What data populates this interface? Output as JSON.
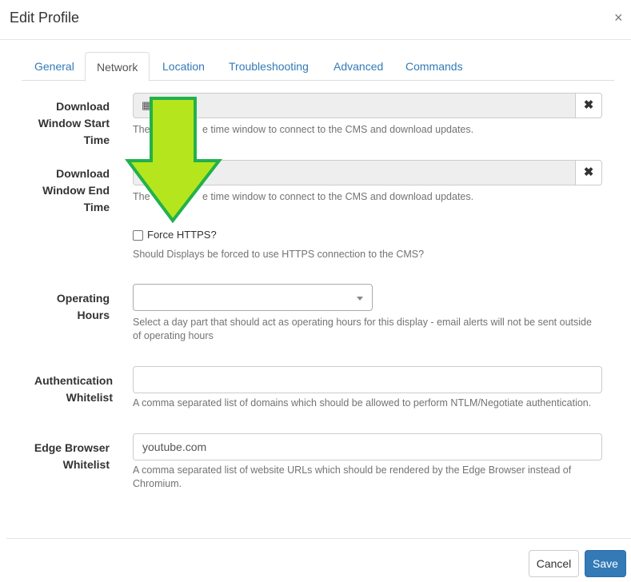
{
  "dialog": {
    "title": "Edit Profile",
    "close_label": "×"
  },
  "tabs": [
    {
      "label": "General"
    },
    {
      "label": "Network"
    },
    {
      "label": "Location"
    },
    {
      "label": "Troubleshooting"
    },
    {
      "label": "Advanced"
    },
    {
      "label": "Commands"
    }
  ],
  "active_tab": "Network",
  "form": {
    "download_start": {
      "label_lines": [
        "Download",
        "Window Start",
        "Time"
      ],
      "value": "",
      "help_left": "The",
      "help_right": "e time window to connect to the CMS and download updates.",
      "clear_label": "✖"
    },
    "download_end": {
      "label_lines": [
        "Download",
        "Window End",
        "Time"
      ],
      "value": "",
      "help_left": "The",
      "help_right": "e time window to connect to the CMS and download updates.",
      "clear_label": "✖"
    },
    "force_https": {
      "label": "Force HTTPS?",
      "checked": false,
      "help": "Should Displays be forced to use HTTPS connection to the CMS?"
    },
    "operating_hours": {
      "label_lines": [
        "Operating",
        "Hours"
      ],
      "selected_value": "",
      "help_lines": [
        "Select a day part that should act as operating hours for this display - email alerts will not be sent outside",
        "of operating hours"
      ]
    },
    "auth_whitelist": {
      "label_lines": [
        "Authentication",
        "Whitelist"
      ],
      "value": "",
      "help": "A comma separated list of domains which should be allowed to perform NTLM/Negotiate authentication."
    },
    "edge_whitelist": {
      "label_lines": [
        "Edge Browser",
        "Whitelist"
      ],
      "value": "youtube.com",
      "help_lines": [
        "A comma separated list of website URLs which should be rendered by the Edge Browser instead of",
        "Chromium."
      ]
    }
  },
  "footer": {
    "cancel_label": "Cancel",
    "save_label": "Save"
  },
  "colors": {
    "accent": "#337ab7",
    "arrow_fill": "#b5e61d",
    "arrow_stroke": "#22b14c"
  },
  "icons": {
    "calendar": "calendar-icon",
    "clear": "clear-icon",
    "close": "close-icon",
    "select_arrow": "chevron-down-icon",
    "overlay_arrow": "arrow-down-icon"
  }
}
